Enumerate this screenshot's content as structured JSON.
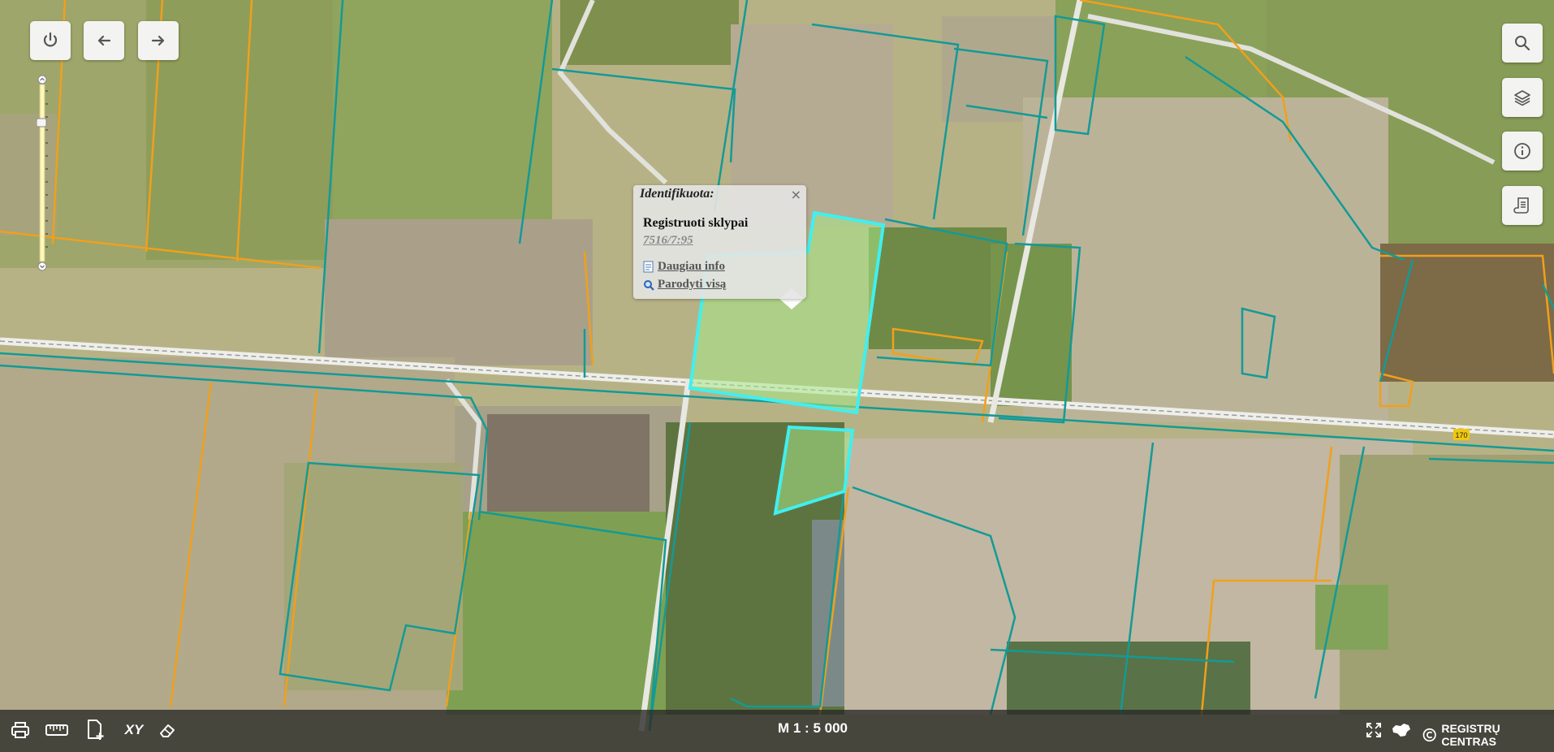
{
  "toolbar": {
    "power_icon": "power-icon",
    "back_icon": "arrow-left-icon",
    "forward_icon": "arrow-right-icon"
  },
  "right_tools": {
    "search_icon": "search-icon",
    "layers_icon": "layers-icon",
    "info_icon": "info-icon",
    "legend_icon": "scroll-icon"
  },
  "popup": {
    "title": "Identifikuota:",
    "close": "×",
    "layer_name": "Registruoti sklypai",
    "parcel_id": "7516/7:95",
    "more_info": "Daugiau info",
    "show_all": "Parodyti visą"
  },
  "road_label": "170",
  "bottom": {
    "scale": "M 1 : 5 000",
    "brand": "REGISTRŲ CENTRAS",
    "tools": [
      "print-icon",
      "ruler-icon",
      "add-document-icon",
      "xy-coordinates-icon",
      "eraser-icon"
    ],
    "xy_label": "XY"
  },
  "colors": {
    "parcel_teal": "#139a96",
    "parcel_orange": "#f0a01c",
    "selected_cyan": "#3ff0f0",
    "selected_fill": "#a8e889"
  }
}
